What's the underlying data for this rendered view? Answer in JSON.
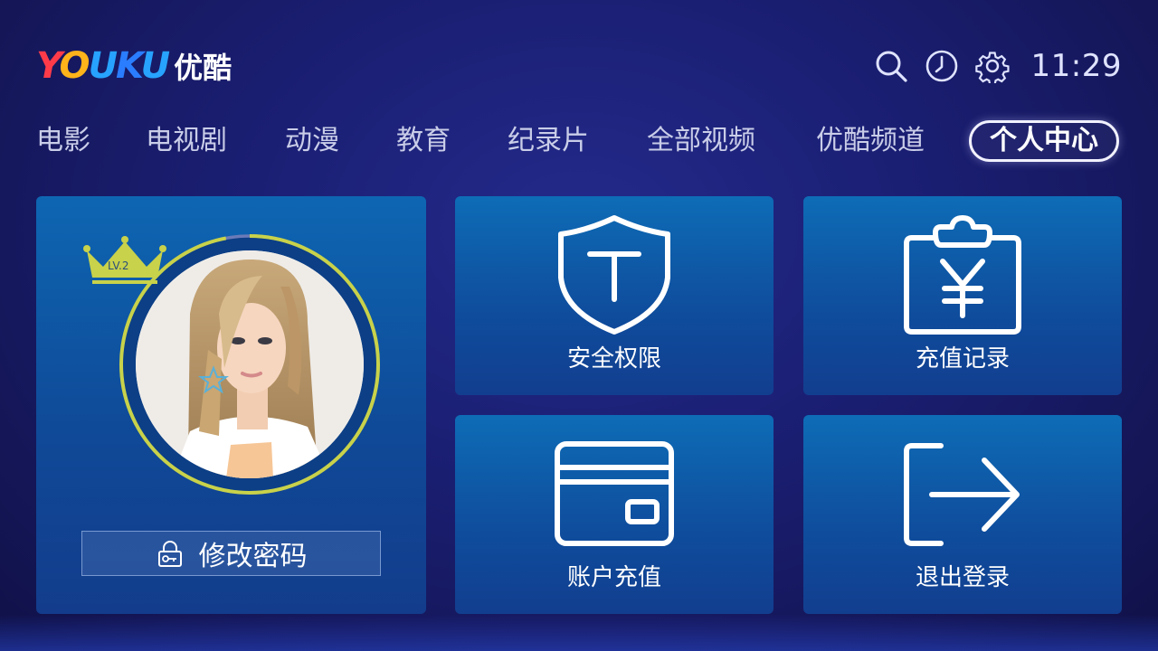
{
  "header": {
    "logo_text": "YOUKU",
    "logo_cn": "优酷",
    "time": "11:29",
    "icons": [
      "search-icon",
      "history-icon",
      "settings-icon"
    ]
  },
  "nav": {
    "items": [
      {
        "label": "电影"
      },
      {
        "label": "电视剧"
      },
      {
        "label": "动漫"
      },
      {
        "label": "教育"
      },
      {
        "label": "纪录片"
      },
      {
        "label": "全部视频"
      },
      {
        "label": "优酷频道"
      },
      {
        "label": "个人中心",
        "active": true
      }
    ]
  },
  "profile": {
    "level": "LV.2",
    "change_password_label": "修改密码",
    "avatar": "user-avatar-photo",
    "level_progress": 0.97
  },
  "tiles": {
    "security": {
      "label": "安全权限",
      "icon": "shield-icon"
    },
    "recharge_record": {
      "label": "充值记录",
      "icon": "yuan-clipboard-icon"
    },
    "account_recharge": {
      "label": "账户充值",
      "icon": "card-icon"
    },
    "logout": {
      "label": "退出登录",
      "icon": "logout-icon"
    }
  },
  "colors": {
    "background": "#1b1f74",
    "card": "#0f5aa8",
    "accent_ring": "#c8d24a",
    "crown": "#c8d24a"
  }
}
